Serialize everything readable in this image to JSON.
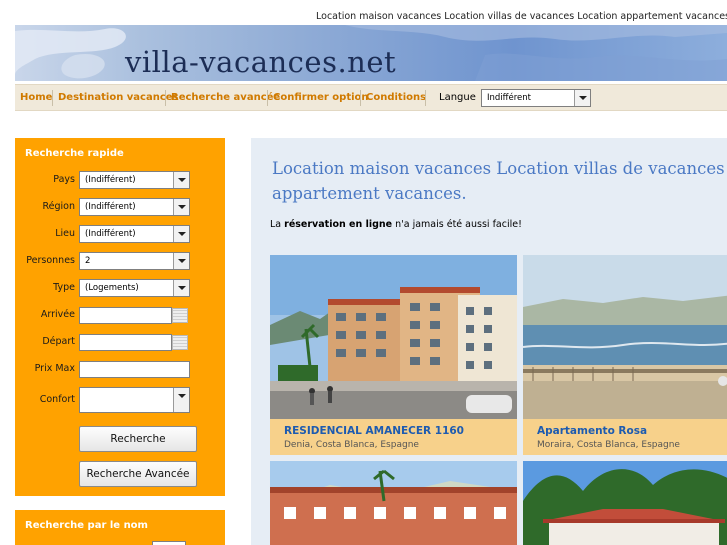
{
  "header": {
    "tagline": "Location maison vacances Location villas de vacances Location appartement vacances.",
    "site_title": "villa-vacances.net"
  },
  "nav": {
    "items": [
      "Home",
      "Destination vacances",
      "Recherche avancée",
      "Confirmer option",
      "Conditions"
    ],
    "langue_label": "Langue",
    "langue_value": "Indifférent"
  },
  "sidebar": {
    "title": "Recherche rapide",
    "fields": {
      "pays": {
        "label": "Pays",
        "value": "(Indifférent)"
      },
      "region": {
        "label": "Région",
        "value": "(Indifférent)"
      },
      "lieu": {
        "label": "Lieu",
        "value": "(Indifférent)"
      },
      "personnes": {
        "label": "Personnes",
        "value": "2"
      },
      "type": {
        "label": "Type",
        "value": "(Logements)"
      },
      "arrivee": {
        "label": "Arrivée",
        "value": ""
      },
      "depart": {
        "label": "Départ",
        "value": ""
      },
      "prix_max": {
        "label": "Prix Max",
        "value": ""
      },
      "confort": {
        "label": "Confort",
        "value": ""
      }
    },
    "search_button": "Recherche",
    "advanced_button": "Recherche Avancée",
    "name_search_title": "Recherche par le nom"
  },
  "main": {
    "heading_line1": "Location maison vacances Location villas de vacances Location",
    "heading_line2": "appartement vacances.",
    "intro_pre": "La ",
    "intro_bold": "réservation en ligne",
    "intro_post": " n'a jamais été aussi facile!",
    "listings": [
      {
        "name": "RESIDENCIAL AMANECER 1160",
        "location": "Denia,  Costa Blanca,  Espagne"
      },
      {
        "name": "Apartamento Rosa",
        "location": "Moraira,  Costa Blanca,  Espagne"
      }
    ]
  }
}
